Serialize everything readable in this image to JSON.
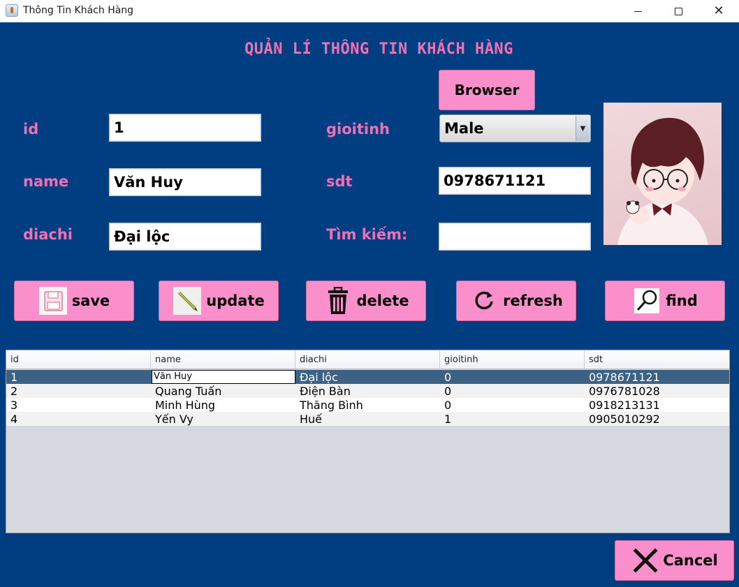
{
  "window": {
    "title": "Thông Tin Khách Hàng"
  },
  "heading": "QUẢN LÍ THÔNG TIN KHÁCH HÀNG",
  "form": {
    "id_label": "id",
    "id_value": "1",
    "name_label": "name",
    "name_value": "Văn Huy",
    "diachi_label": "diachi",
    "diachi_value": "Đại lộc",
    "gioitinh_label": "gioitinh",
    "gioitinh_value": "Male",
    "sdt_label": "sdt",
    "sdt_value": "0978671121",
    "search_label": "Tìm kiếm:",
    "search_value": "",
    "browser_label": "Browser"
  },
  "actions": {
    "save": "save",
    "update": "update",
    "delete": "delete",
    "refresh": "refresh",
    "find": "find",
    "cancel": "Cancel"
  },
  "table": {
    "columns": [
      "id",
      "name",
      "diachi",
      "gioitinh",
      "sdt"
    ],
    "rows": [
      [
        "1",
        "Văn Huy",
        "Đại lộc",
        "0",
        "0978671121"
      ],
      [
        "2",
        "Quang Tuấn",
        "Điện Bàn",
        "0",
        "0976781028"
      ],
      [
        "3",
        "Minh Hùng",
        "Thăng Bình",
        "0",
        "0918213131"
      ],
      [
        "4",
        "Yến Vy",
        "Huế",
        "1",
        "0905010292"
      ]
    ],
    "selected_row": 0,
    "editing_cell_value": "Văn Huy"
  },
  "colors": {
    "background": "#003e82",
    "accent_pink": "#f26fb4",
    "button_pink": "#fa8fcb",
    "selected_row": "#3b6285"
  },
  "icons": {
    "save": "floppy-disk-icon",
    "update": "pencil-icon",
    "delete": "trash-can-icon",
    "refresh": "refresh-icon",
    "find": "magnifier-icon",
    "cancel": "x-icon"
  }
}
